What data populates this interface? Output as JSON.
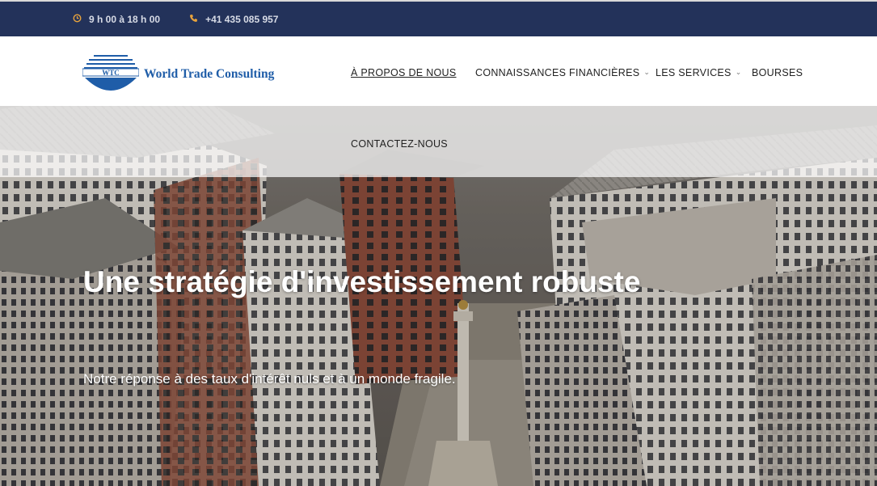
{
  "topbar": {
    "hours": "9 h 00 à 18 h 00",
    "phone": "+41 435 085 957",
    "hours_icon": "clock-icon",
    "phone_icon": "phone-icon"
  },
  "brand": {
    "logo_text": "WTC",
    "name": "World Trade Consulting"
  },
  "nav": {
    "items": [
      {
        "label": "À PROPOS DE NOUS"
      },
      {
        "label": "CONNAISSANCES FINANCIÈRES"
      },
      {
        "label": "LES SERVICES"
      },
      {
        "label": "BOURSES"
      },
      {
        "label": "CONTACTEZ-NOUS"
      }
    ]
  },
  "hero": {
    "headline": "Une stratégie d'investissement robuste",
    "subline": "Notre réponse à des taux d'intérêt nuls et à un monde fragile."
  },
  "colors": {
    "topbar": "#23325a",
    "accent": "#e8a33c",
    "brand_blue": "#1f5da8"
  }
}
